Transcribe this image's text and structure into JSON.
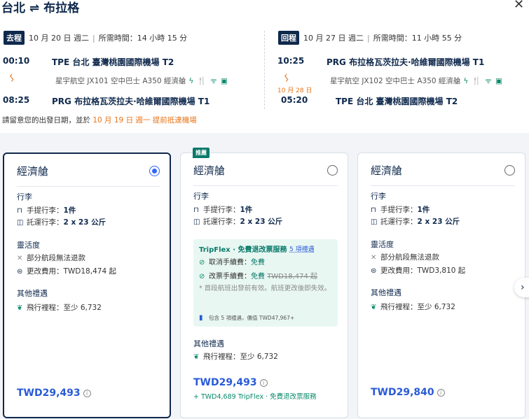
{
  "header": {
    "title": "台北 ⇌ 布拉格",
    "close_glyph": "✕"
  },
  "outbound": {
    "tag": "去程",
    "date": "10 月 20 日 週二",
    "duration": "所需時間：14 小時 15 分",
    "dep_time": "00:10",
    "dep_airport": "TPE 台北 臺灣桃園國際機場 T2",
    "flight_info": "星宇航空  JX101  空中巴士 A350  經濟艙",
    "arr_time": "08:25",
    "arr_airport": "PRG 布拉格瓦茨拉夫·哈維爾國際機場 T1"
  },
  "inbound": {
    "tag": "回程",
    "date": "10 月 27 日 週二",
    "duration": "所需時間：11 小時 55 分",
    "dep_time": "10:25",
    "dep_airport": "PRG 布拉格瓦茨拉夫·哈維爾國際機場 T1",
    "flight_info": "星宇航空  JX102  空中巴士 A350  經濟艙",
    "next_day": "10 月 28 日",
    "arr_time": "05:20",
    "arr_airport": "TPE 台北 臺灣桃園國際機場 T2"
  },
  "amenities": "ϟ 🍴 ᯤ ▣",
  "notice": {
    "prefix": "請留意您的出發日期，並於 ",
    "highlight": "10 月 19 日 週一 提前抵達機場"
  },
  "cards": [
    {
      "title": "經濟艙",
      "selected": true,
      "baggage_title": "行李",
      "carry_on_label": "手提行李：",
      "carry_on_value": "1件",
      "checked_label": "託運行李：",
      "checked_value": "2 x 23 公斤",
      "flex_title": "靈活度",
      "refund": "部分航段無法退款",
      "change": "更改費用：TWD18,474 起",
      "other_title": "其他禮遇",
      "miles": "飛行裡程：至少 6,732",
      "price": "TWD29,493"
    },
    {
      "title": "經濟艙",
      "selected": false,
      "badge": "推薦",
      "baggage_title": "行李",
      "carry_on_label": "手提行李：",
      "carry_on_value": "1件",
      "checked_label": "託運行李：",
      "checked_value": "2 x 23 公斤",
      "tripflex": {
        "title": "TripFlex · 免費退改票服務",
        "link": "5 項禮遇",
        "cancel_label": "取消手續費：",
        "cancel_value": "免費",
        "change_label": "改票手續費：",
        "change_value": "免費",
        "change_strike": "TWD18,474 起",
        "note": "* 首段航班出發前有效。航班更改後即失效。",
        "footer": "包含 5 項禮遇，價值 TWD47,967+"
      },
      "other_title": "其他禮遇",
      "miles": "飛行裡程：至少 6,732",
      "price": "TWD29,493",
      "price_note": "+ TWD4,689 TripFlex · 免費退改票服務"
    },
    {
      "title": "經濟艙",
      "selected": false,
      "baggage_title": "行李",
      "carry_on_label": "手提行李：",
      "carry_on_value": "1件",
      "checked_label": "託運行李：",
      "checked_value": "2 x 23 公斤",
      "flex_title": "靈活度",
      "refund": "部分航段無法退款",
      "change": "更改費用：TWD3,810 起",
      "other_title": "其他禮遇",
      "miles": "飛行裡程：至少 6,732",
      "price": "TWD29,840"
    }
  ],
  "colors": {
    "primary": "#0f294d",
    "price": "#2a5bd7",
    "accent": "#e8741a",
    "flex_green": "#0a7a6a"
  }
}
